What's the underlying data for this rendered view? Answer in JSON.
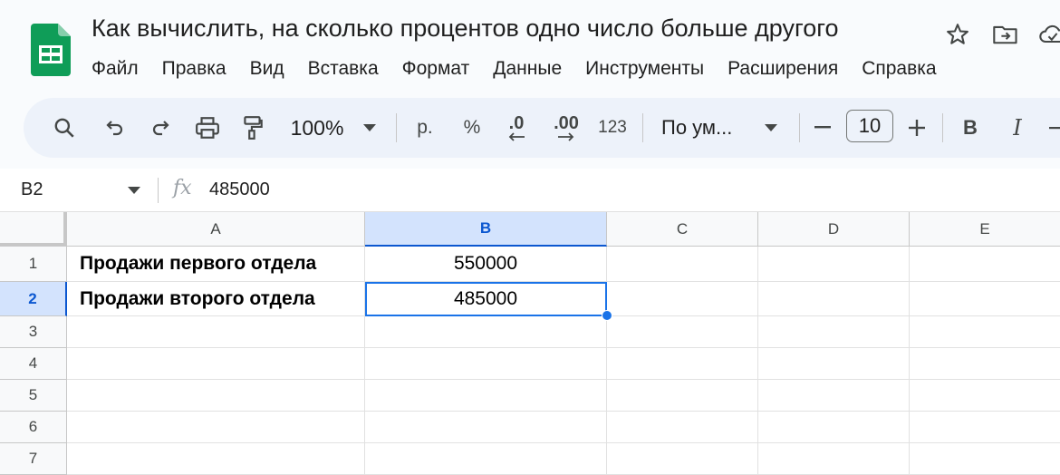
{
  "document": {
    "title": "Как вычислить, на сколько процентов одно число больше другого"
  },
  "menu": {
    "items": [
      "Файл",
      "Правка",
      "Вид",
      "Вставка",
      "Формат",
      "Данные",
      "Инструменты",
      "Расширения",
      "Справка"
    ]
  },
  "toolbar": {
    "zoom": "100%",
    "currency": "р.",
    "percent": "%",
    "decrease_decimals": ".0",
    "increase_decimals": ".00",
    "number_format": "123",
    "font": "По ум...",
    "font_size": "10",
    "bold": "B",
    "italic": "I"
  },
  "formula_bar": {
    "cell_ref": "B2",
    "fx": "fx",
    "value": "485000"
  },
  "sheet": {
    "columns": [
      "A",
      "B",
      "C",
      "D",
      "E"
    ],
    "rows": [
      "1",
      "2",
      "3",
      "4",
      "5",
      "6",
      "7"
    ],
    "active_column": "B",
    "active_row": "2",
    "cells": {
      "A1": "Продажи первого отдела",
      "B1": "550000",
      "A2": "Продажи второго отдела",
      "B2": "485000"
    }
  },
  "colors": {
    "selection": "#1a73e8",
    "header_active_bg": "#d3e3fd",
    "toolbar_bg": "#edf2fa",
    "sheets_green": "#0f9d58"
  },
  "icons": [
    "sheets-logo-icon",
    "star-icon",
    "move-to-folder-icon",
    "cloud-status-icon",
    "search-icon",
    "undo-icon",
    "redo-icon",
    "print-icon",
    "paint-format-icon",
    "dropdown-arrow-icon",
    "minus-icon",
    "plus-icon",
    "strikethrough-icon"
  ]
}
